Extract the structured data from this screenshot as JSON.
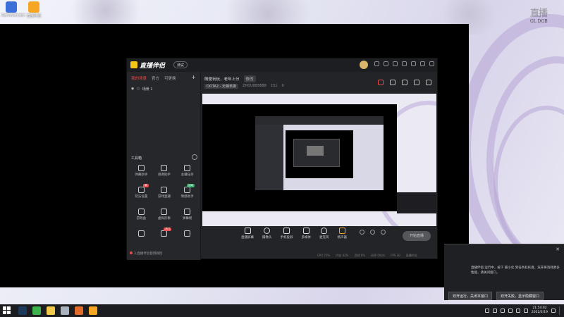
{
  "desktop": {
    "icons": [
      {
        "label": "Administrator",
        "color": "#3d6fd8"
      },
      {
        "label": "直播伴侣",
        "color": "#f5a623"
      }
    ],
    "watermark": {
      "big": "直播",
      "small": "GL DGB"
    }
  },
  "app": {
    "brand": "直播伴侣",
    "beta_label": "测试",
    "left_tabs": [
      "我的场景",
      "官方",
      "可更换"
    ],
    "scene_label": "场景 1",
    "tools_heading": "工具箱",
    "tools": [
      {
        "label": "弹幕助手",
        "badge": ""
      },
      {
        "label": "感谢助手",
        "badge": ""
      },
      {
        "label": "主播任务",
        "badge": ""
      },
      {
        "label": "玩法设置",
        "badge": "新"
      },
      {
        "label": "游戏直播",
        "badge": ""
      },
      {
        "label": "情感助手",
        "badge": "活动"
      },
      {
        "label": "游戏盒",
        "badge": ""
      },
      {
        "label": "虚拟形象",
        "badge": ""
      },
      {
        "label": "弹幕姬",
        "badge": ""
      },
      {
        "label": "数据",
        "badge": ""
      },
      {
        "label": "热门",
        "badge": "热门"
      },
      {
        "label": "更多",
        "badge": ""
      }
    ],
    "left_footer": "3.直播伴侣使用教程",
    "room_title": "随便玩玩，老年上分",
    "room_title_tag": "修改",
    "room_game": "DOTA2 - 天梯单排",
    "room_id": "ZHOU888888",
    "room_viewers": "151",
    "room_likes": "0",
    "controls": [
      "直播屏幕",
      "摄像头",
      "手机投屏",
      "多媒体",
      "麦克风",
      "扬声器"
    ],
    "start_button": "开始直播",
    "status": [
      "CPU 23%",
      "内存 42%",
      "丢帧 0%",
      "码率 0kb/s",
      "FPS 30",
      "直播时长"
    ]
  },
  "notification": {
    "text": "直播伴侣 运行中，按下 最小化 到任务栏托盘，双开将消耗更多性能，请关闭窗口。",
    "buttons": [
      "双开运行，关闭本窗口",
      "双开失败，显示隐藏窗口"
    ]
  },
  "taskbar": {
    "apps": [
      {
        "name": "steam",
        "color": "#1b3a5c"
      },
      {
        "name": "wechat",
        "color": "#3bb24c"
      },
      {
        "name": "app3",
        "color": "#f2c94c"
      },
      {
        "name": "app4",
        "color": "#a9b2bd"
      },
      {
        "name": "app5",
        "color": "#e06b2b"
      },
      {
        "name": "app6",
        "color": "#f5a623"
      }
    ],
    "time": "21:54:02",
    "date": "2022/2/19"
  }
}
